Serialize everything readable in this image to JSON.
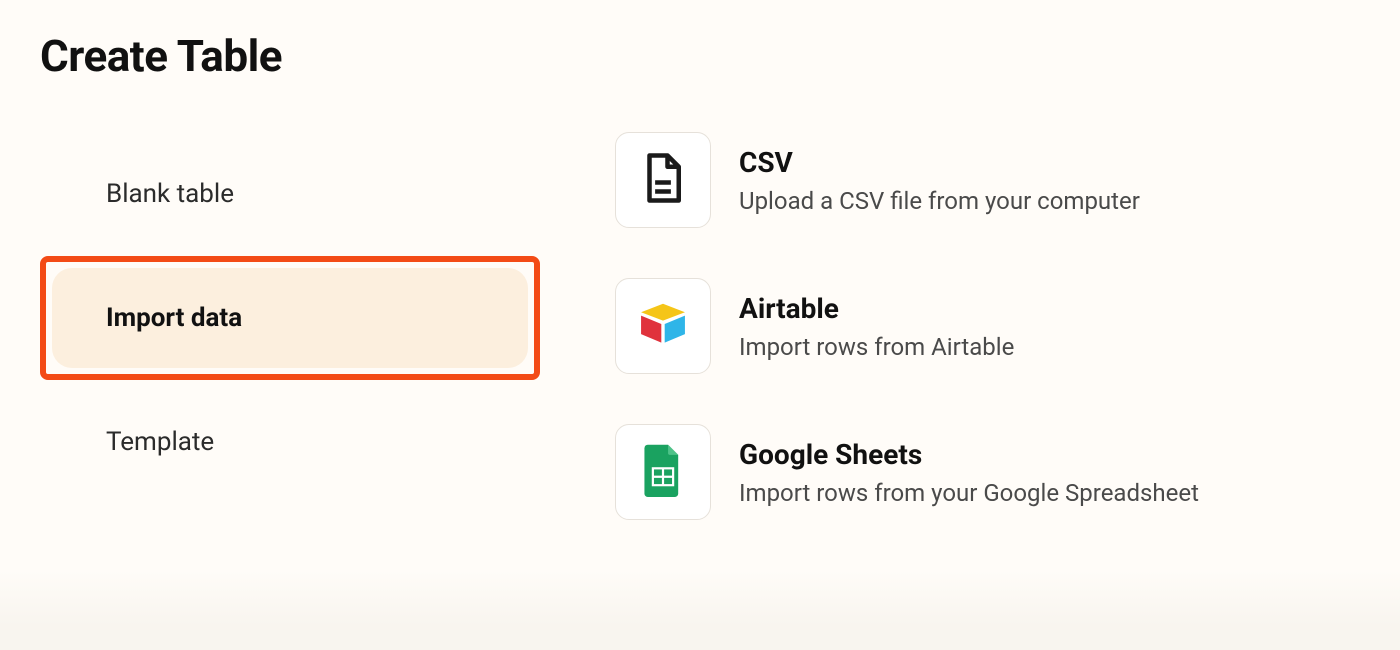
{
  "header": {
    "title": "Create Table"
  },
  "sidebar": {
    "items": [
      {
        "label": "Blank table",
        "active": false
      },
      {
        "label": "Import data",
        "active": true
      },
      {
        "label": "Template",
        "active": false
      }
    ]
  },
  "options": [
    {
      "icon": "file-csv-icon",
      "title": "CSV",
      "description": "Upload a CSV file from your computer"
    },
    {
      "icon": "airtable-icon",
      "title": "Airtable",
      "description": "Import rows from Airtable"
    },
    {
      "icon": "google-sheets-icon",
      "title": "Google Sheets",
      "description": "Import rows from your Google Spreadsheet"
    }
  ],
  "colors": {
    "highlight_border": "#f34b16",
    "highlight_fill": "#fcefde",
    "page_bg": "#fffcf8"
  }
}
